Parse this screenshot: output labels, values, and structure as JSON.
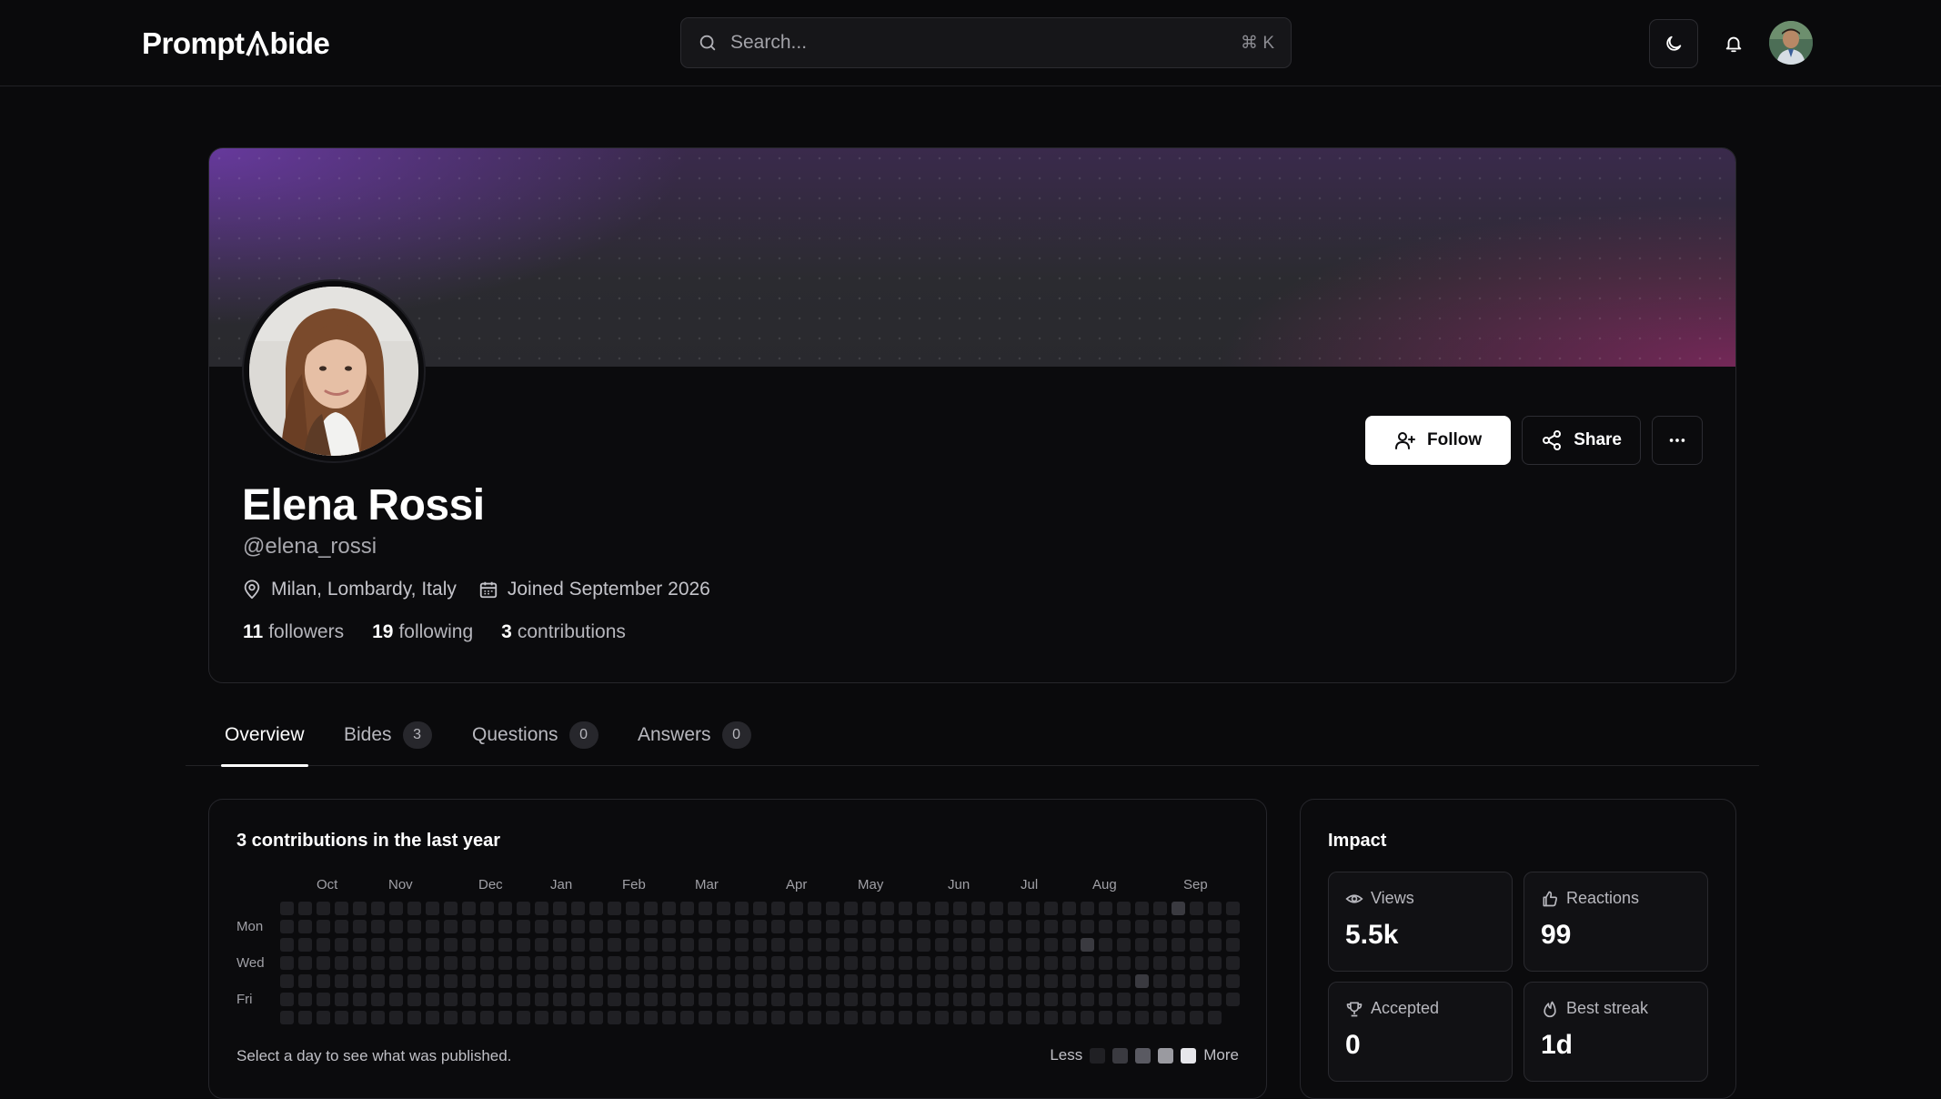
{
  "header": {
    "logo_left": "Prompt",
    "logo_right": "bide",
    "search_placeholder": "Search...",
    "search_shortcut": "⌘ K",
    "icons": [
      "search-icon",
      "moon-icon",
      "bell-icon"
    ]
  },
  "profile": {
    "name": "Elena Rossi",
    "handle": "@elena_rossi",
    "location": "Milan, Lombardy, Italy",
    "joined": "Joined September 2026",
    "followers_count": "11",
    "followers_label": "followers",
    "following_count": "19",
    "following_label": "following",
    "contributions_count": "3",
    "contributions_label": "contributions",
    "follow_label": "Follow",
    "share_label": "Share"
  },
  "tabs": [
    {
      "label": "Overview",
      "count": null,
      "active": true
    },
    {
      "label": "Bides",
      "count": "3"
    },
    {
      "label": "Questions",
      "count": "0"
    },
    {
      "label": "Answers",
      "count": "0"
    }
  ],
  "contributions": {
    "title": "3 contributions in the last year",
    "months": [
      "Oct",
      "Nov",
      "Dec",
      "Jan",
      "Feb",
      "Mar",
      "Apr",
      "May",
      "Jun",
      "Jul",
      "Aug",
      "Sep"
    ],
    "day_labels": [
      "Mon",
      "Wed",
      "Fri"
    ],
    "footer": "Select a day to see what was published.",
    "legend_less": "Less",
    "legend_more": "More",
    "weeks": 53,
    "active_cells": [
      {
        "week": 49,
        "day": 0,
        "level": 1
      },
      {
        "week": 44,
        "day": 2,
        "level": 1
      },
      {
        "week": 47,
        "day": 4,
        "level": 1
      }
    ],
    "colors": [
      "#202024",
      "#3a3a40",
      "#5a5a62",
      "#9a9aa0",
      "#e6e6ea"
    ]
  },
  "impact": {
    "title": "Impact",
    "metrics": [
      {
        "label": "Views",
        "value": "5.5k",
        "icon": "eye-icon"
      },
      {
        "label": "Reactions",
        "value": "99",
        "icon": "thumbs-up-icon"
      },
      {
        "label": "Accepted",
        "value": "0",
        "icon": "trophy-icon"
      },
      {
        "label": "Best streak",
        "value": "1d",
        "icon": "flame-icon"
      }
    ]
  }
}
